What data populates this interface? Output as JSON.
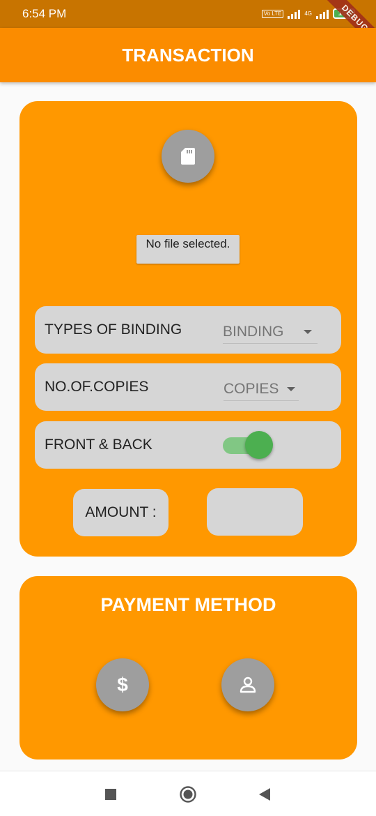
{
  "status_bar": {
    "time": "6:54 PM",
    "volte": "Vo LTE",
    "network": "4G",
    "battery": "100"
  },
  "debug_banner": "DEBUG",
  "app_bar": {
    "title": "TRANSACTION"
  },
  "transaction": {
    "file_status": "No file selected.",
    "binding": {
      "label": "TYPES OF BINDING",
      "value": "BINDING"
    },
    "copies": {
      "label": "NO.OF.COPIES",
      "value": "COPIES"
    },
    "front_back": {
      "label": "FRONT & BACK",
      "enabled": true
    },
    "amount": {
      "label": "AMOUNT :",
      "value": ""
    }
  },
  "payment": {
    "title": "PAYMENT METHOD",
    "cash_icon": "$",
    "icons": [
      "sd-card-icon",
      "dollar-icon",
      "person-icon"
    ]
  },
  "colors": {
    "status_bar": "#c87400",
    "app_bar": "#fb8c00",
    "card": "#ff9800",
    "field": "#d6d6d6",
    "fab": "#9e9e9e",
    "switch_on": "#4caf50"
  }
}
